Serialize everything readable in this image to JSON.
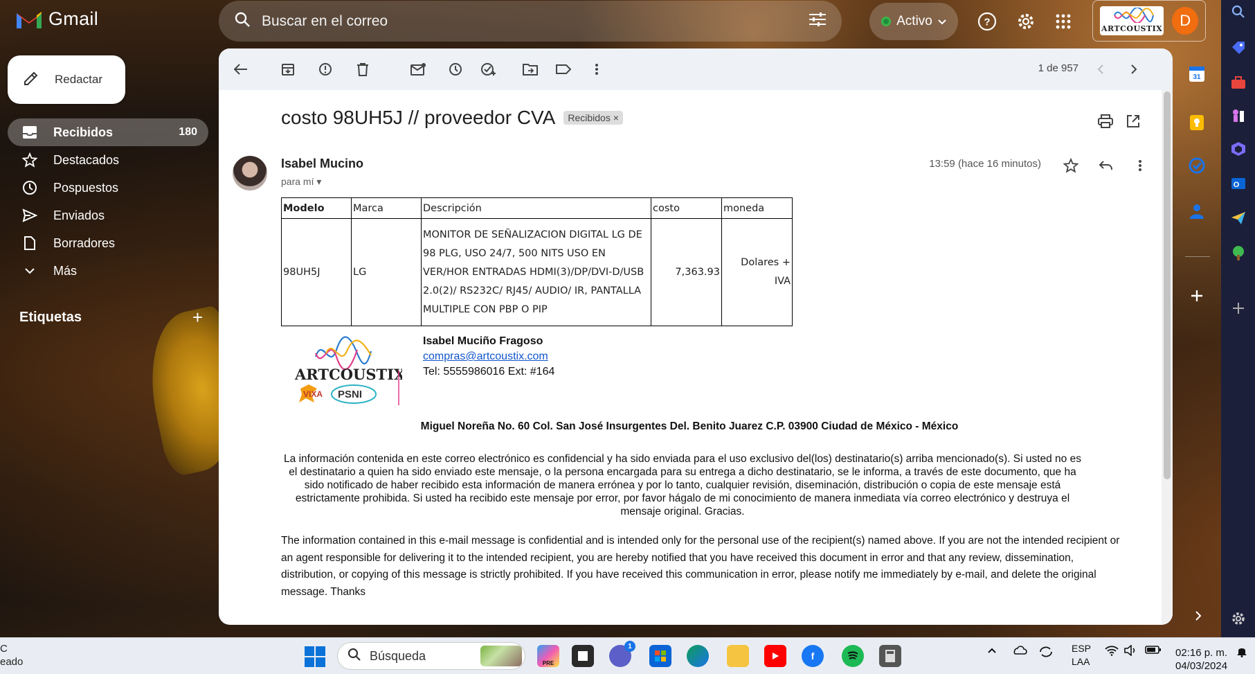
{
  "app": {
    "name": "Gmail"
  },
  "search": {
    "placeholder": "Buscar en el correo"
  },
  "status": {
    "label": "Activo"
  },
  "account": {
    "initial": "D",
    "brand_text": "ARTCOUSTIX"
  },
  "compose": {
    "label": "Redactar"
  },
  "nav": {
    "items": [
      {
        "label": "Recibidos",
        "count": "180",
        "icon": "inbox-icon"
      },
      {
        "label": "Destacados",
        "icon": "star-icon"
      },
      {
        "label": "Pospuestos",
        "icon": "clock-icon"
      },
      {
        "label": "Enviados",
        "icon": "send-icon"
      },
      {
        "label": "Borradores",
        "icon": "file-icon"
      },
      {
        "label": "Más",
        "icon": "chevron-down-icon"
      }
    ],
    "labels_title": "Etiquetas"
  },
  "toolbar": {
    "pager": "1 de 957"
  },
  "message": {
    "subject": "costo 98UH5J // proveedor CVA",
    "chip": "Recibidos",
    "sender": "Isabel Mucino",
    "to": "para mí",
    "time": "13:59 (hace 16 minutos)"
  },
  "table": {
    "headers": [
      "Modelo",
      "Marca",
      "Descripción",
      "costo",
      "moneda"
    ],
    "row": {
      "modelo": "98UH5J",
      "marca": "LG",
      "descripcion": "MONITOR DE SEÑALIZACION DIGITAL LG DE 98 PLG, USO 24/7, 500 NITS USO EN VER/HOR ENTRADAS HDMI(3)/DP/DVI-D/USB 2.0(2)/ RS232C/ RJ45/ AUDIO/ IR, PANTALLA MULTIPLE CON PBP O PIP",
      "costo": "7,363.93",
      "moneda": "Dolares + IVA"
    }
  },
  "signature": {
    "logo_text": "ARTCOUSTIX",
    "vixa": "VIXA",
    "psni": "PSNI",
    "name": "Isabel Muciño Fragoso",
    "email": "compras@artcoustix.com",
    "tel": "Tel: 5555986016 Ext: #164",
    "address": "Miguel Noreña No. 60 Col. San José Insurgentes Del. Benito Juarez C.P. 03900 Ciudad de México - México"
  },
  "disclaimer_es": "La información contenida en este correo electrónico es confidencial y ha sido enviada para el uso exclusivo del(los) destinatario(s) arriba mencionado(s). Si usted no es el destinatario a quien ha sido enviado este mensaje, o la persona encargada para su entrega a dicho destinatario, se le informa, a través de este documento, que ha sido notificado de haber recibido esta información de manera errónea y por lo tanto, cualquier revisión, diseminación, distribución o copia de este mensaje está estrictamente prohibida. Si usted ha recibido este mensaje por error, por favor hágalo de mi conocimiento de manera inmediata vía correo electrónico y destruya el mensaje original. Gracias.",
  "disclaimer_en": "The information contained in this e-mail message is confidential and is intended only for the personal use of the recipient(s) named above. If you are not the intended recipient or an agent responsible for delivering it to the intended recipient, you are hereby notified that you have received this document in error and that any review, dissemination, distribution, or copying of this message is strictly prohibited. If you have received this communication in error, please notify me immediately by e-mail, and delete the original message. Thanks",
  "taskbar": {
    "left_line1": "C",
    "left_line2": "eado",
    "search_placeholder": "Búsqueda",
    "teams_badge": "1",
    "lang_line1": "ESP",
    "lang_line2": "LAA",
    "time": "02:16 p. m.",
    "date": "04/03/2024"
  },
  "colors": {
    "accent": "#0b57d0",
    "avatar": "#f06d10",
    "link": "#1155cc",
    "active_dot": "#1e8e3e"
  }
}
